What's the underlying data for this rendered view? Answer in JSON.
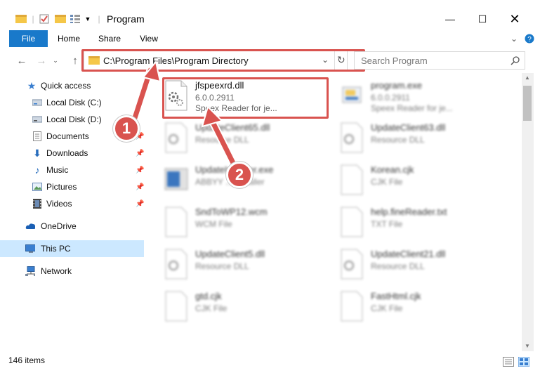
{
  "window": {
    "title": "Program"
  },
  "ribbon": {
    "tabs": [
      "File",
      "Home",
      "Share",
      "View"
    ]
  },
  "address": {
    "path": "C:\\Program Files\\Program Directory",
    "search_placeholder": "Search Program"
  },
  "sidebar": {
    "items": [
      {
        "label": "Quick access",
        "icon": "star-icon",
        "pinned": false
      },
      {
        "label": "Local Disk (C:)",
        "icon": "drive-icon",
        "pinned": false
      },
      {
        "label": "Local Disk (D:)",
        "icon": "drive-icon",
        "pinned": false
      },
      {
        "label": "Documents",
        "icon": "documents-icon",
        "pinned": true
      },
      {
        "label": "Downloads",
        "icon": "download-icon",
        "pinned": true
      },
      {
        "label": "Music",
        "icon": "music-icon",
        "pinned": true
      },
      {
        "label": "Pictures",
        "icon": "pictures-icon",
        "pinned": true
      },
      {
        "label": "Videos",
        "icon": "videos-icon",
        "pinned": true
      },
      {
        "label": "OneDrive",
        "icon": "cloud-icon",
        "pinned": false
      },
      {
        "label": "This PC",
        "icon": "computer-icon",
        "pinned": false
      },
      {
        "label": "Network",
        "icon": "network-icon",
        "pinned": false
      }
    ]
  },
  "files": {
    "highlighted": {
      "name": "jfspeexrd.dll",
      "line2": "6.0.0.2911",
      "line3": "Speex Reader for je..."
    },
    "others": [
      {
        "name": "program.exe",
        "line2": "6.0.0.2911",
        "line3": "Speex Reader for je..."
      },
      {
        "name": "UpdateClient65.dll",
        "line2": "Resource DLL"
      },
      {
        "name": "UpdateClient63.dll",
        "line2": "Resource DLL"
      },
      {
        "name": "UpdateInstaller.exe",
        "line2": "ABBYY ... Installer"
      },
      {
        "name": "Korean.cjk",
        "line2": "CJK File"
      },
      {
        "name": "SndToWP12.wcm",
        "line2": "WCM File"
      },
      {
        "name": "help.fineReader.txt",
        "line2": "TXT File"
      },
      {
        "name": "UpdateClient5.dll",
        "line2": "Resource DLL"
      },
      {
        "name": "UpdateClient21.dll",
        "line2": "Resource DLL"
      },
      {
        "name": "gtd.cjk",
        "line2": "CJK File"
      },
      {
        "name": "FastHtml.cjk",
        "line2": "CJK File"
      }
    ]
  },
  "status": {
    "items_count": "146 items"
  },
  "annotations": {
    "step1": "1",
    "step2": "2"
  },
  "colors": {
    "accent": "#1979ca",
    "highlight": "#d9534f",
    "selected": "#cce8ff"
  }
}
